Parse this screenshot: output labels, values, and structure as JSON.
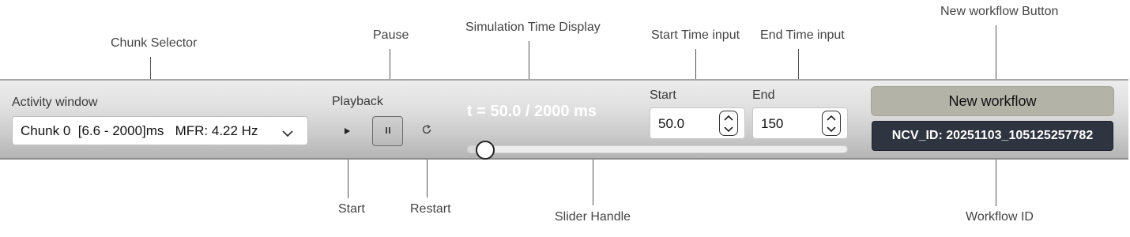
{
  "annotations": {
    "chunk_selector": "Chunk Selector",
    "pause": "Pause",
    "simulation_time_display": "Simulation Time Display",
    "start_time_input": "Start Time input",
    "end_time_input": "End Time input",
    "new_workflow_button": "New workflow Button",
    "start": "Start",
    "restart": "Restart",
    "slider_handle": "Slider Handle",
    "workflow_id": "Workflow ID"
  },
  "toolbar": {
    "activity_window_label": "Activity window",
    "chunk_select_value": "Chunk 0  [6.6 - 2000]ms   MFR: 4.22 Hz",
    "playback_label": "Playback",
    "time_display": "t = 50.0 / 2000 ms",
    "slider_fraction": 0.025,
    "start_label": "Start",
    "start_value": "50.0",
    "end_label": "End",
    "end_value": "150",
    "new_workflow_label": "New workflow",
    "workflow_id": "NCV_ID: 20251103_105125257782"
  },
  "icons": {
    "chunk_select": "chevron-down-icon",
    "start": "play-icon",
    "pause": "pause-icon",
    "restart": "restart-icon",
    "spin_up": "chevron-up-icon",
    "spin_down": "chevron-down-icon"
  },
  "colors": {
    "workflow_id_bg": "#2e3440",
    "new_workflow_bg": "#b3b3a8",
    "toolbar_top": "#ececec",
    "toolbar_bottom": "#b4b4b4"
  }
}
